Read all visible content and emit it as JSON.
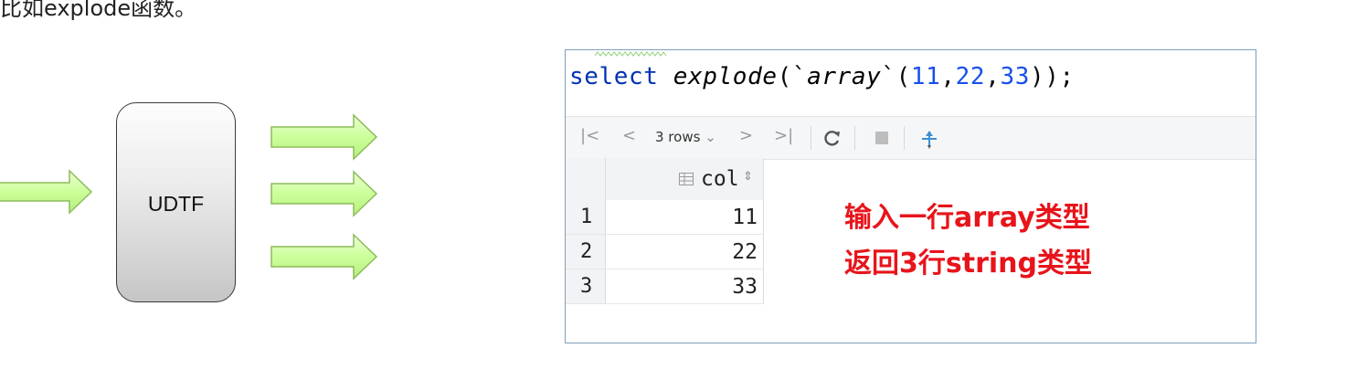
{
  "caption": "比如explode函数。",
  "diagram": {
    "box_label": "UDTF",
    "arrow_color": "#ccff99"
  },
  "ide": {
    "sql": {
      "keyword": "select",
      "function": "explode",
      "open": "(`",
      "inner": "array",
      "mid": "`(",
      "n1": "11",
      "c1": ",",
      "n2": "22",
      "c2": ",",
      "n3": "33",
      "close": "));"
    },
    "toolbar": {
      "first_icon": "first-page-icon",
      "prev_icon": "prev-page-icon",
      "rows_label": "3 rows",
      "next_icon": "next-page-icon",
      "last_icon": "last-page-icon",
      "refresh_icon": "refresh-icon",
      "stop_icon": "stop-icon",
      "pin_icon": "pin-icon"
    },
    "grid": {
      "column": "col",
      "rows": [
        {
          "n": "1",
          "v": "11"
        },
        {
          "n": "2",
          "v": "22"
        },
        {
          "n": "3",
          "v": "33"
        }
      ]
    },
    "annotations": [
      "输入一行array类型",
      "返回3行string类型"
    ]
  },
  "colors": {
    "keyword": "#0033b3",
    "number": "#1750eb",
    "annotation": "#e8141b"
  }
}
